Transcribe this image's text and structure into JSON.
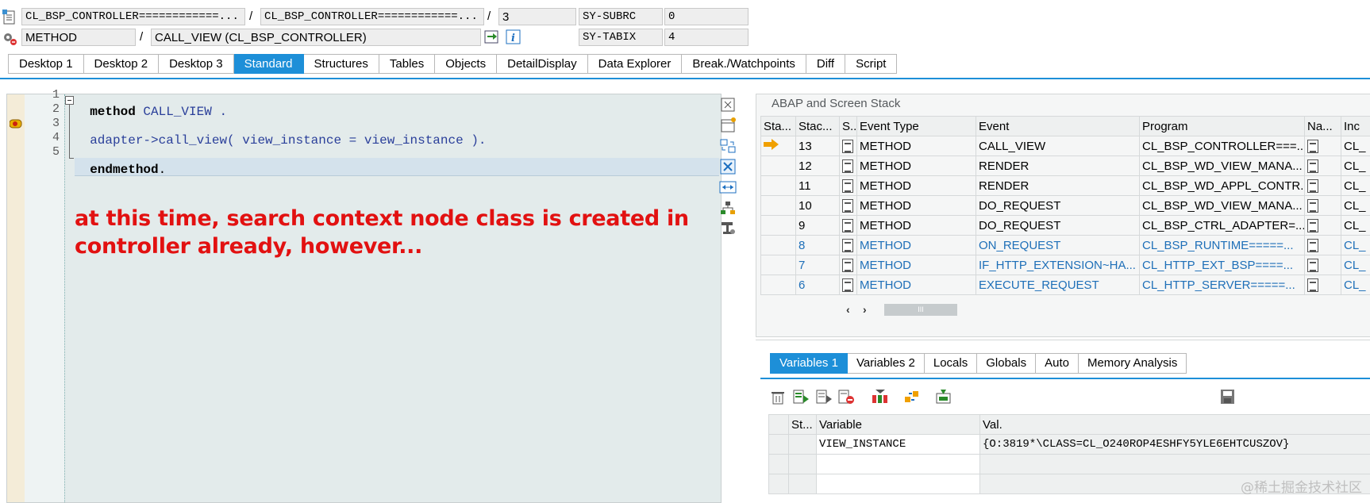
{
  "header": {
    "row1": {
      "class_1": "CL_BSP_CONTROLLER============...",
      "class_2": "CL_BSP_CONTROLLER============...",
      "line": "3",
      "sys_label_1": "SY-SUBRC",
      "sys_value_1": "0"
    },
    "row2": {
      "type": "METHOD",
      "method": "CALL_VIEW (CL_BSP_CONTROLLER)",
      "sys_label_2": "SY-TABIX",
      "sys_value_2": "4"
    },
    "separator": "/"
  },
  "tabs": [
    "Desktop 1",
    "Desktop 2",
    "Desktop 3",
    "Standard",
    "Structures",
    "Tables",
    "Objects",
    "DetailDisplay",
    "Data Explorer",
    "Break./Watchpoints",
    "Diff",
    "Script"
  ],
  "active_tab": "Standard",
  "editor": {
    "line_numbers": [
      "1",
      "2",
      "3",
      "4",
      "5"
    ],
    "line1_kw": "method",
    "line1_id": "CALL_VIEW",
    "line1_end": " .",
    "line3_a": "adapter",
    "line3_b": "->",
    "line3_c": "call_view",
    "line3_d": "( ",
    "line3_e": "view_instance",
    "line3_f": " = ",
    "line3_g": "view_instance",
    "line3_h": " ).",
    "line5_kw": "endmethod",
    "line5_end": ".",
    "annotation_line1": "at this time, search context node class is created in",
    "annotation_line2": "controller already, however..."
  },
  "stack": {
    "title": "ABAP and Screen Stack",
    "columns": [
      "Sta...",
      "Stac...",
      "S..",
      "Event Type",
      "Event",
      "Program",
      "Na...",
      "Inc"
    ],
    "rows": [
      {
        "level": "13",
        "type": "METHOD",
        "event": "CALL_VIEW",
        "program": "CL_BSP_CONTROLLER===...",
        "inc": "CL_",
        "current": true
      },
      {
        "level": "12",
        "type": "METHOD",
        "event": "RENDER",
        "program": "CL_BSP_WD_VIEW_MANA...",
        "inc": "CL_"
      },
      {
        "level": "11",
        "type": "METHOD",
        "event": "RENDER",
        "program": "CL_BSP_WD_APPL_CONTR...",
        "inc": "CL_"
      },
      {
        "level": "10",
        "type": "METHOD",
        "event": "DO_REQUEST",
        "program": "CL_BSP_WD_VIEW_MANA...",
        "inc": "CL_"
      },
      {
        "level": "9",
        "type": "METHOD",
        "event": "DO_REQUEST",
        "program": "CL_BSP_CTRL_ADAPTER=...",
        "inc": "CL_"
      },
      {
        "level": "8",
        "type": "METHOD",
        "event": "ON_REQUEST",
        "program": "CL_BSP_RUNTIME=====...",
        "inc": "CL_",
        "blue": true
      },
      {
        "level": "7",
        "type": "METHOD",
        "event": "IF_HTTP_EXTENSION~HA...",
        "program": "CL_HTTP_EXT_BSP====...",
        "inc": "CL_",
        "blue": true
      },
      {
        "level": "6",
        "type": "METHOD",
        "event": "EXECUTE_REQUEST",
        "program": "CL_HTTP_SERVER=====...",
        "inc": "CL_",
        "blue": true
      }
    ],
    "scroll_thumb": "III"
  },
  "variables": {
    "tabs": [
      "Variables 1",
      "Variables 2",
      "Locals",
      "Globals",
      "Auto",
      "Memory Analysis"
    ],
    "active_tab": "Variables 1",
    "columns": [
      "St...",
      "Variable",
      "Val."
    ],
    "rows": [
      {
        "variable": "VIEW_INSTANCE",
        "value": "{O:3819*\\CLASS=CL_O240ROP4ESHFY5YLE6EHTCUSZOV}"
      }
    ]
  },
  "watermark": "@稀土掘金技术社区",
  "colors": {
    "accent": "#1d8fd8",
    "annotation": "#e21111",
    "blue_rows": "#1e6fb8"
  }
}
